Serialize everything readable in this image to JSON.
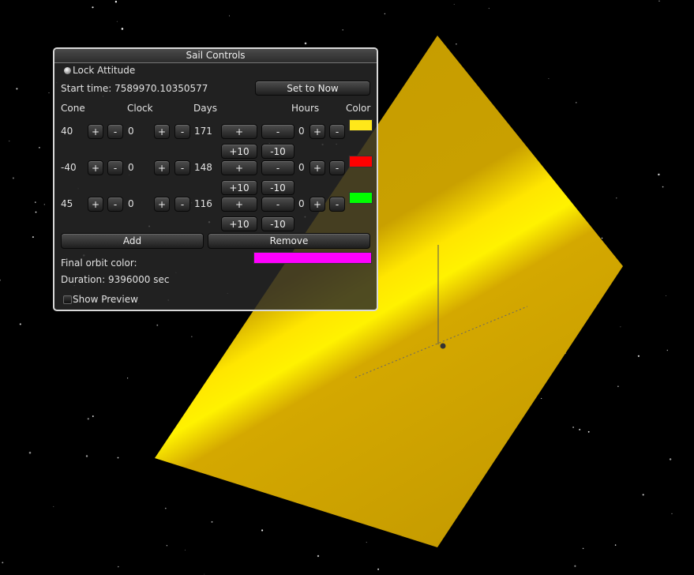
{
  "panel": {
    "title": "Sail Controls",
    "lock_attitude_label": "Lock Attitude",
    "start_time_label": "Start time: 7589970.10350577",
    "set_now_label": "Set to Now",
    "headers": {
      "cone": "Cone",
      "clock": "Clock",
      "days": "Days",
      "hours": "Hours",
      "color": "Color"
    },
    "rows": [
      {
        "cone": "40",
        "clock": "0",
        "days": "171",
        "hours": "0",
        "color": "#ffe81a"
      },
      {
        "cone": "-40",
        "clock": "0",
        "days": "148",
        "hours": "0",
        "color": "#ff0000"
      },
      {
        "cone": "45",
        "clock": "0",
        "days": "116",
        "hours": "0",
        "color": "#00ff00"
      }
    ],
    "plus": "+",
    "minus": "-",
    "plus10": "+10",
    "minus10": "-10",
    "add_label": "Add",
    "remove_label": "Remove",
    "final_orbit_label": "Final orbit color:",
    "final_orbit_color": "#ff00ff",
    "duration_label": "Duration: 9396000 sec",
    "show_preview_label": "Show Preview"
  },
  "scene": {
    "sail_color": "#c9a000",
    "sail_highlight": "#fff200",
    "background": "#000000"
  }
}
